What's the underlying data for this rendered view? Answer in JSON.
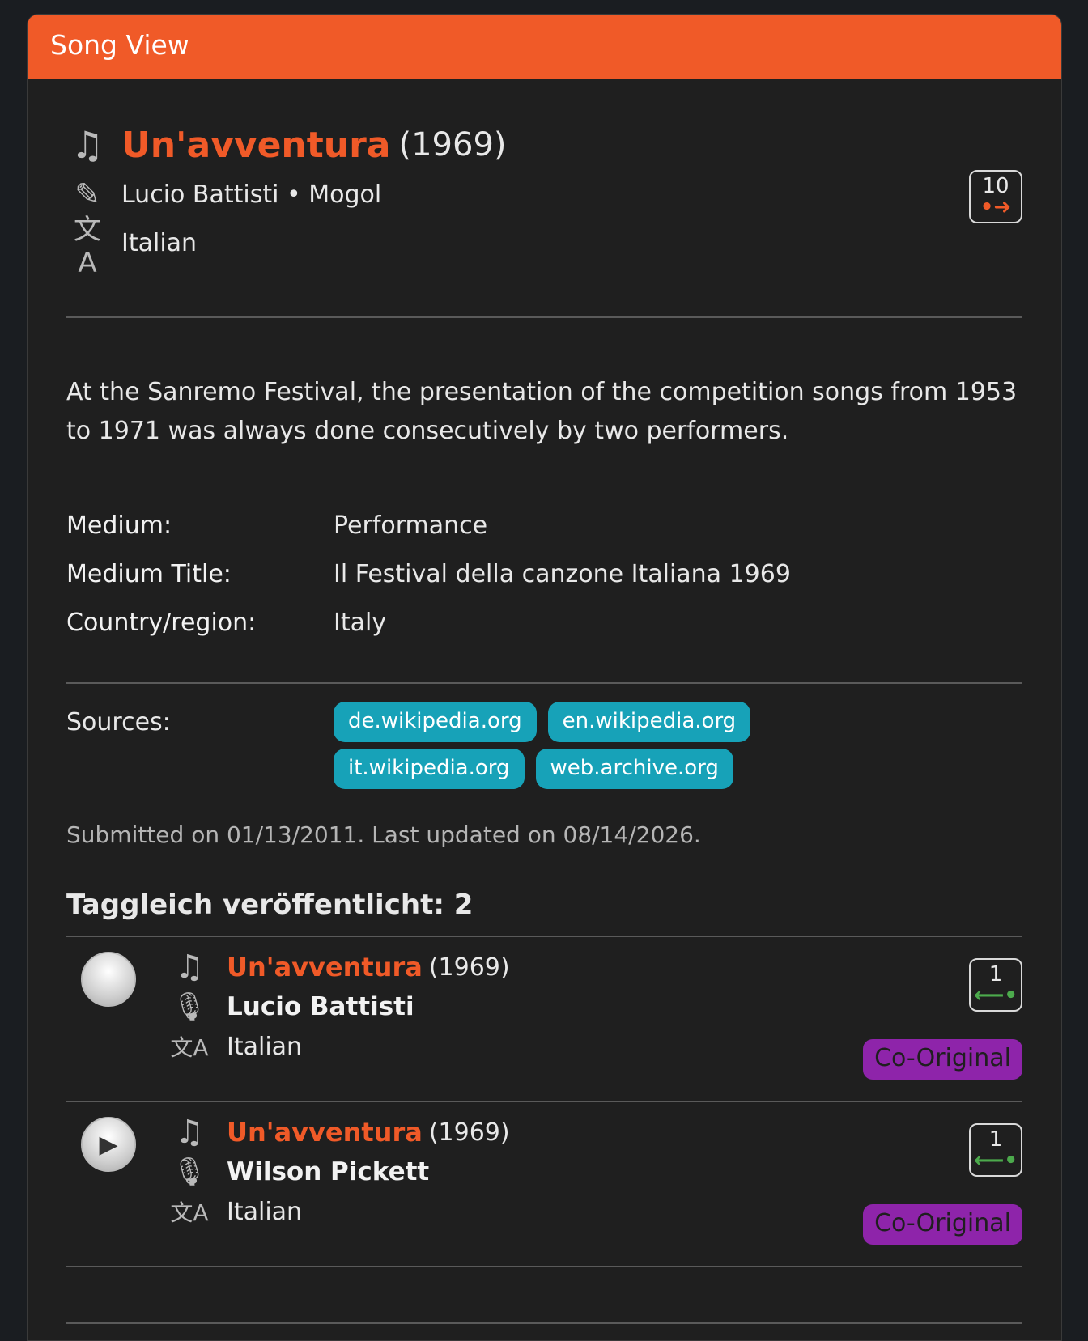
{
  "header": {
    "title": "Song View"
  },
  "song": {
    "title": "Un'avventura",
    "year": "(1969)",
    "writers": "Lucio Battisti • Mogol",
    "language": "Italian",
    "versions_count": "10",
    "icons": {
      "song": "music-note-icon",
      "writer": "pencil-icon",
      "language": "translate-icon",
      "versions": "arrow-right-icon"
    }
  },
  "description": "At the Sanremo Festival, the presentation of the competition songs from 1953 to 1971 was always done consecutively by two performers.",
  "facts": [
    {
      "label": "Medium:",
      "value": "Performance"
    },
    {
      "label": "Medium Title:",
      "value": "Il Festival della canzone Italiana 1969"
    },
    {
      "label": "Country/region:",
      "value": "Italy"
    }
  ],
  "sources": {
    "label": "Sources:",
    "items": [
      "de.wikipedia.org",
      "en.wikipedia.org",
      "it.wikipedia.org",
      "web.archive.org"
    ]
  },
  "submitted": "Submitted on 01/13/2011. Last updated on 08/14/2026.",
  "same_day": {
    "title": "Taggleich veröffentlicht: 2",
    "items": [
      {
        "title": "Un'avventura",
        "year": "(1969)",
        "artist": "Lucio Battisti",
        "language": "Italian",
        "count": "1",
        "tag": "Co-Original",
        "player": "blank"
      },
      {
        "title": "Un'avventura",
        "year": "(1969)",
        "artist": "Wilson Pickett",
        "language": "Italian",
        "count": "1",
        "tag": "Co-Original",
        "player": "play"
      }
    ]
  },
  "colors": {
    "accent": "#f05a28",
    "chip": "#17a2b8",
    "tag": "#8e24aa",
    "green": "#4caa4c"
  }
}
